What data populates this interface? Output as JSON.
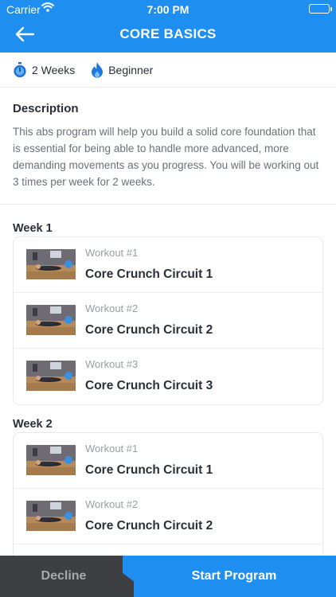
{
  "status_bar": {
    "carrier": "Carrier",
    "time": "7:00 PM"
  },
  "nav": {
    "title": "CORE BASICS",
    "back_icon": "arrow-left-icon"
  },
  "meta": {
    "duration": "2 Weeks",
    "duration_icon": "stopwatch-icon",
    "level": "Beginner",
    "level_icon": "flame-icon"
  },
  "description": {
    "heading": "Description",
    "body": "This abs program will help you build a solid core foundation that is essential for being able to handle more advanced, more demanding movements as you progress. You will be working out 3 times per week for 2 weeks."
  },
  "weeks": [
    {
      "label": "Week 1",
      "workouts": [
        {
          "number": "Workout #1",
          "name": "Core Crunch Circuit 1"
        },
        {
          "number": "Workout #2",
          "name": "Core Crunch Circuit 2"
        },
        {
          "number": "Workout #3",
          "name": "Core Crunch Circuit 3"
        }
      ]
    },
    {
      "label": "Week 2",
      "workouts": [
        {
          "number": "Workout #1",
          "name": "Core Crunch Circuit 1"
        },
        {
          "number": "Workout #2",
          "name": "Core Crunch Circuit 2"
        }
      ]
    }
  ],
  "footer": {
    "decline_label": "Decline",
    "start_label": "Start Program"
  },
  "colors": {
    "brand_blue": "#1e8ff0",
    "dark_button": "#3d3f42",
    "text": "#2b2f36",
    "muted": "#9a9ea5"
  }
}
